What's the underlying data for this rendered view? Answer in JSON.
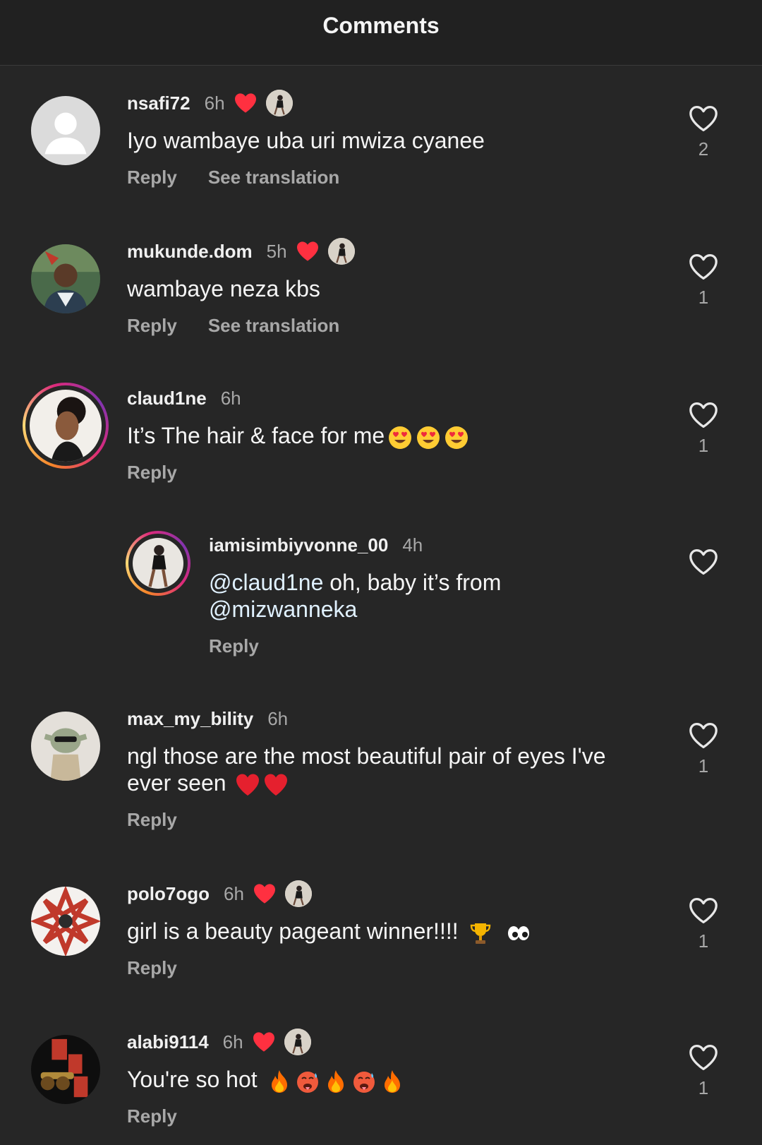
{
  "header": {
    "title": "Comments"
  },
  "comments": [
    {
      "username": "nsafi72",
      "time": "6h",
      "text": "Iyo wambaye uba uri mwiza cyanee",
      "reply": "Reply",
      "translate": "See translation",
      "likes": "2"
    },
    {
      "username": "mukunde.dom",
      "time": "5h",
      "text": "wambaye neza kbs",
      "reply": "Reply",
      "translate": "See translation",
      "likes": "1"
    },
    {
      "username": "claud1ne",
      "time": "6h",
      "text": "It’s The hair & face for me",
      "reply": "Reply",
      "likes": "1"
    },
    {
      "username": "iamisimbiyvonne_00",
      "time": "4h",
      "mention1": "@claud1ne",
      "text_mid": " oh, baby it’s from",
      "mention2": "@mizwanneka",
      "reply": "Reply"
    },
    {
      "username": "max_my_bility",
      "time": "6h",
      "text": "ngl those are the most beautiful pair of eyes I've ever seen",
      "reply": "Reply",
      "likes": "1"
    },
    {
      "username": "polo7ogo",
      "time": "6h",
      "text": "girl is a beauty pageant winner!!!!",
      "reply": "Reply",
      "likes": "1"
    },
    {
      "username": "alabi9114",
      "time": "6h",
      "text": "You're so hot",
      "reply": "Reply",
      "likes": "1"
    }
  ],
  "colors": {
    "background": "#262626",
    "liked_heart": "#ff3040",
    "muted_text": "#a8a8a8",
    "mention": "#e0f1ff"
  }
}
